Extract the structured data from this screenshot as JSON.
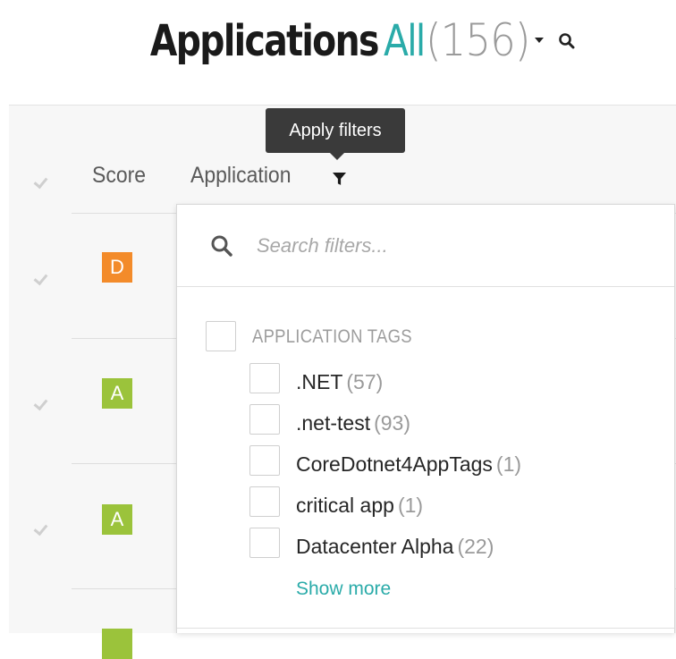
{
  "header": {
    "title": "Applications",
    "filter_label": "All",
    "count": "(156)"
  },
  "table": {
    "columns": {
      "score": "Score",
      "application": "Application"
    },
    "rows": [
      {
        "grade": "D",
        "color": "#f38b2a"
      },
      {
        "grade": "A",
        "color": "#9bc33b"
      },
      {
        "grade": "A",
        "color": "#9bc33b"
      }
    ]
  },
  "tooltip": {
    "text": "Apply filters"
  },
  "filters": {
    "search_placeholder": "Search filters...",
    "group_label": "APPLICATION TAGS",
    "options": [
      {
        "label": ".NET",
        "count": "(57)"
      },
      {
        "label": ".net-test",
        "count": "(93)"
      },
      {
        "label": "CoreDotnet4AppTags",
        "count": "(1)"
      },
      {
        "label": "critical app",
        "count": "(1)"
      },
      {
        "label": "Datacenter Alpha",
        "count": "(22)"
      }
    ],
    "show_more": "Show more"
  },
  "colors": {
    "accent": "#2aaba9",
    "grade_d": "#f38b2a",
    "grade_a": "#9bc33b"
  }
}
